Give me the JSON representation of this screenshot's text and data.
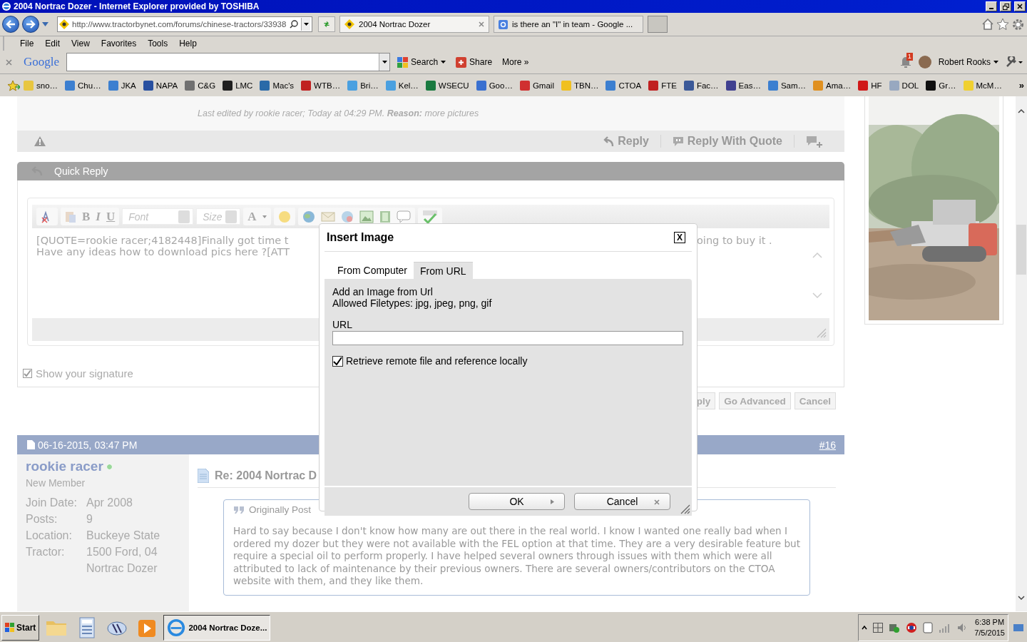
{
  "window": {
    "title": "2004 Nortrac Dozer - Internet Explorer provided by TOSHIBA"
  },
  "address_bar": {
    "url": "http://www.tractorbynet.com/forums/chinese-tractors/33938"
  },
  "tabs": [
    {
      "label": "2004 Nortrac Dozer",
      "selected": true
    },
    {
      "label": "is there an \"I\" in team - Google ...",
      "selected": false
    }
  ],
  "menu": [
    "File",
    "Edit",
    "View",
    "Favorites",
    "Tools",
    "Help"
  ],
  "google_toolbar": {
    "logo": "Google",
    "search_button": "Search",
    "share_button": "Share",
    "more_button": "More »",
    "notification_count": "1",
    "user_name": "Robert Rooks"
  },
  "favorites": [
    {
      "label": "sno…",
      "color": "#e8c640"
    },
    {
      "label": "Chu…",
      "color": "#3c7fd0"
    },
    {
      "label": "JKA",
      "color": "#3c7fd0"
    },
    {
      "label": "NAPA",
      "color": "#2850a0"
    },
    {
      "label": "C&G",
      "color": "#707070"
    },
    {
      "label": "LMC",
      "color": "#202020"
    },
    {
      "label": "Mac's",
      "color": "#2a6aa8"
    },
    {
      "label": "WTB…",
      "color": "#c02020"
    },
    {
      "label": "Bri…",
      "color": "#4aa0e0"
    },
    {
      "label": "Kel…",
      "color": "#4aa0e0"
    },
    {
      "label": "WSECU",
      "color": "#1a7a40"
    },
    {
      "label": "Goo…",
      "color": "#3a70d0"
    },
    {
      "label": "Gmail",
      "color": "#d03030"
    },
    {
      "label": "TBN…",
      "color": "#f0c020"
    },
    {
      "label": "CTOA",
      "color": "#3c7fd0"
    },
    {
      "label": "FTE",
      "color": "#c02020"
    },
    {
      "label": "Fac…",
      "color": "#3b5998"
    },
    {
      "label": "Eas…",
      "color": "#404090"
    },
    {
      "label": "Sam…",
      "color": "#3c7fd0"
    },
    {
      "label": "Ama…",
      "color": "#e09020"
    },
    {
      "label": "HF",
      "color": "#d01818"
    },
    {
      "label": "DOL",
      "color": "#98a8c0"
    },
    {
      "label": "Gr…",
      "color": "#101010"
    },
    {
      "label": "McM…",
      "color": "#f0d030"
    }
  ],
  "favorites_more": "»",
  "post_footer": {
    "edit_note": "Last edited by rookie racer; Today at 04:29 PM. **Reason:** more pictures",
    "actions": [
      "Reply",
      "Reply With Quote"
    ]
  },
  "quick_reply": {
    "title": "Quick Reply",
    "format_buttons": [
      "B",
      "I",
      "U"
    ],
    "font_placeholder": "Font",
    "size_placeholder": "Size",
    "color_button": "A",
    "editor_lines": [
      "[QUOTE=rookie racer;4182448]Finally got time t",
      "Have any ideas how to download pics here ?[ATT"
    ],
    "editor_line_right": "oing to buy it .",
    "show_signature": {
      "label": "Show your signature",
      "checked": true
    },
    "buttons": [
      "ply",
      "Go Advanced",
      "Cancel"
    ]
  },
  "post": {
    "date": "06-16-2015, 03:47 PM",
    "number": "#16",
    "user": {
      "name": "rookie racer",
      "online": true,
      "rank": "New Member",
      "details": [
        {
          "label": "Join Date:",
          "value": "Apr 2008"
        },
        {
          "label": "Posts:",
          "value": "9"
        },
        {
          "label": "Location:",
          "value": "Buckeye State"
        },
        {
          "label": "Tractor:",
          "value": "1500 Ford, 04 Nortrac Dozer"
        }
      ]
    },
    "title": "Re: 2004 Nortrac D",
    "quote": {
      "header": "Originally Post",
      "text": "Hard to say because I don't know how many are out there in the real world. I know I wanted one really bad when I ordered my dozer but they were not available with the FEL option at that time. They are a very desirable feature but require a special oil to perform properly. I have helped several owners through issues with them which were all attributed to lack of maintenance by their previous owners. There are several owners/contributors on the CTOA website with them, and they like them."
    }
  },
  "dialog": {
    "title": "Insert Image",
    "close": "X",
    "tabs": [
      {
        "label": "From Computer",
        "selected": false
      },
      {
        "label": "From URL",
        "selected": true
      }
    ],
    "intro_lines": [
      "Add an Image from Url",
      "Allowed Filetypes: jpg, jpeg, png, gif"
    ],
    "url_label": "URL",
    "retrieve": {
      "label": "Retrieve remote file and reference locally",
      "checked": true
    },
    "buttons": [
      {
        "label": "OK",
        "kind": "ok"
      },
      {
        "label": "Cancel",
        "kind": "cancel"
      }
    ]
  },
  "taskbar": {
    "start": "Start",
    "tasks": [
      {
        "label": "2004 Nortrac Doze...",
        "selected": true
      }
    ],
    "time": "6:38 PM",
    "date": "7/5/2015"
  }
}
